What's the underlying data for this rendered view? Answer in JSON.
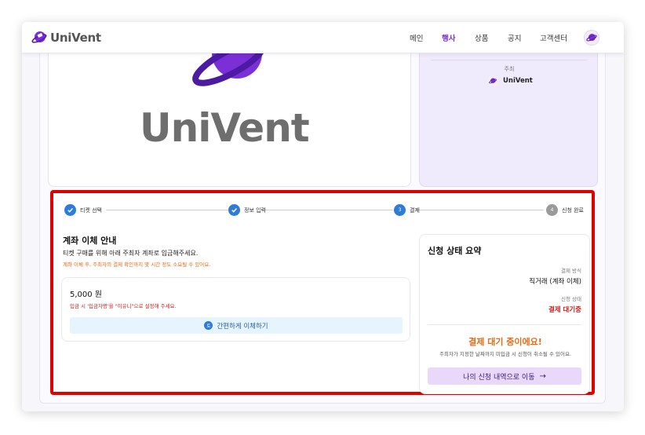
{
  "nav": {
    "logo_text": "UniVent",
    "items": [
      {
        "label": "메인"
      },
      {
        "label": "행사",
        "active": true
      },
      {
        "label": "상품"
      },
      {
        "label": "공지"
      },
      {
        "label": "고객센터"
      }
    ]
  },
  "poster": {
    "brand_text": "UniVent"
  },
  "host": {
    "label": "주최",
    "name": "UniVent"
  },
  "steps": [
    {
      "label": "티켓 선택",
      "state": "done"
    },
    {
      "label": "정보 입력",
      "state": "done"
    },
    {
      "label": "결제",
      "state": "current",
      "number": "3"
    },
    {
      "label": "신청 완료",
      "state": "pending",
      "number": "4"
    }
  ],
  "transfer": {
    "title": "계좌 이체 안내",
    "desc": "티켓 구매를 위해 아래 주최자 계좌로 입금해주세요.",
    "note": "계좌 이체 후, 주최자의 결제 확인까지 몇 시간 정도 소요될 수 있어요.",
    "amount": "5,000 원",
    "warn": "입금 시 '입금자명'을 \"이유니\"으로 설정해 주세요.",
    "easy_icon": "토",
    "easy_label": "간편하게 이체하기"
  },
  "summary": {
    "title": "신청 상태 요약",
    "method_label": "결제 방식",
    "method_value": "직거래 (계좌 이체)",
    "status_label": "신청 상태",
    "status_value": "결제 대기중",
    "wait_title": "결제 대기 중이에요!",
    "wait_desc": "주최자가 지정한 날짜까지 미입금 시 신청이 취소될 수 있어요.",
    "go_label": "나의 신청 내역으로 이동",
    "go_arrow": "→"
  },
  "colors": {
    "brand_purple": "#7b2fd6",
    "highlight_red": "#e00000",
    "step_blue": "#2f7bd8",
    "warn_orange": "#e66a13",
    "error_red": "#d0201e"
  }
}
